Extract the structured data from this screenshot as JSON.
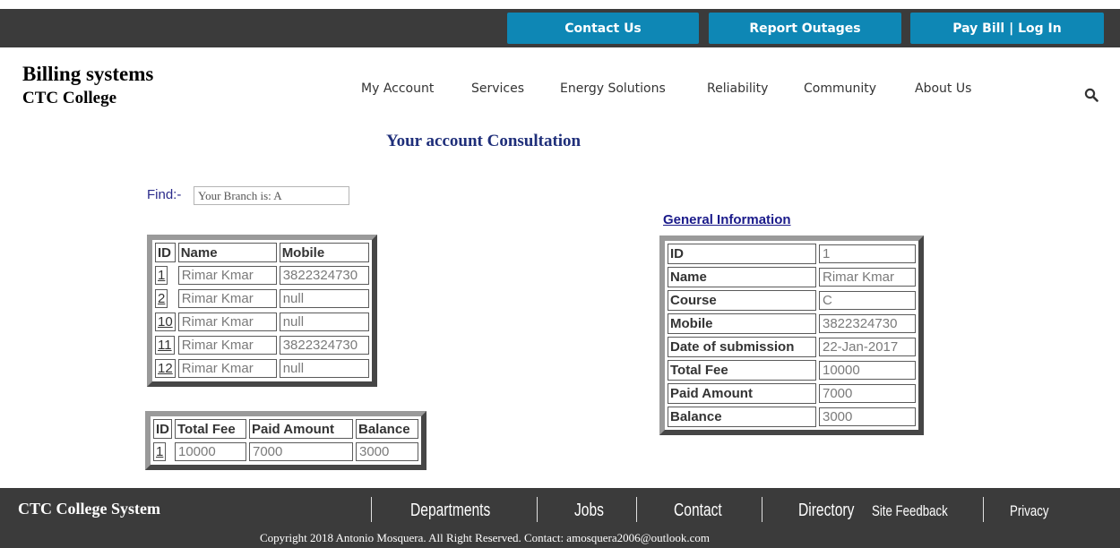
{
  "topbar": {
    "contact_label": "Contact Us",
    "outages_label": "Report Outages",
    "paybill_label": "Pay Bill | Log In"
  },
  "header": {
    "title": "Billing systems",
    "subtitle": "CTC College",
    "nav": [
      "My Account",
      "Services",
      "Energy Solutions",
      "Reliability",
      "Community",
      "About Us"
    ],
    "search_icon": "search-icon"
  },
  "page": {
    "heading": "Your account Consultation"
  },
  "find": {
    "label": "Find:-",
    "value": "Your Branch is: A"
  },
  "students_table": {
    "headers": [
      "ID",
      "Name",
      "Mobile"
    ],
    "rows": [
      {
        "id": "1",
        "name": "Rimar Kmar",
        "mobile": "3822324730"
      },
      {
        "id": "2",
        "name": "Rimar Kmar",
        "mobile": "null"
      },
      {
        "id": "10",
        "name": "Rimar Kmar",
        "mobile": "null"
      },
      {
        "id": "11",
        "name": "Rimar Kmar",
        "mobile": "3822324730"
      },
      {
        "id": "12",
        "name": "Rimar Kmar",
        "mobile": "null"
      }
    ]
  },
  "fee_table": {
    "headers": [
      "ID",
      "Total Fee",
      "Paid Amount",
      "Balance"
    ],
    "rows": [
      {
        "id": "1",
        "total_fee": "10000",
        "paid": "7000",
        "balance": "3000"
      }
    ]
  },
  "general_info": {
    "title": "General Information",
    "fields": [
      {
        "label": "ID",
        "value": "1"
      },
      {
        "label": "Name",
        "value": "Rimar Kmar"
      },
      {
        "label": "Course",
        "value": "C"
      },
      {
        "label": "Mobile",
        "value": "3822324730"
      },
      {
        "label": "Date of submission",
        "value": "22-Jan-2017"
      },
      {
        "label": "Total Fee",
        "value": "10000"
      },
      {
        "label": "Paid Amount",
        "value": "7000"
      },
      {
        "label": "Balance",
        "value": "3000"
      }
    ]
  },
  "footer": {
    "brand": "CTC College System",
    "departments": "Departments",
    "jobs": "Jobs",
    "contact": "Contact",
    "directory": "Directory",
    "feedback": "Site Feedback",
    "privacy": "Privacy",
    "copyright": "Copyright 2018 Antonio Mosquera. All Right Reserved. Contact: amosquera2006@outlook.com"
  },
  "colors": {
    "topbar_bg": "#3b3b3b",
    "button_bg": "#0e87b5",
    "heading": "#1f2f7a",
    "link": "#1a1a8a"
  }
}
